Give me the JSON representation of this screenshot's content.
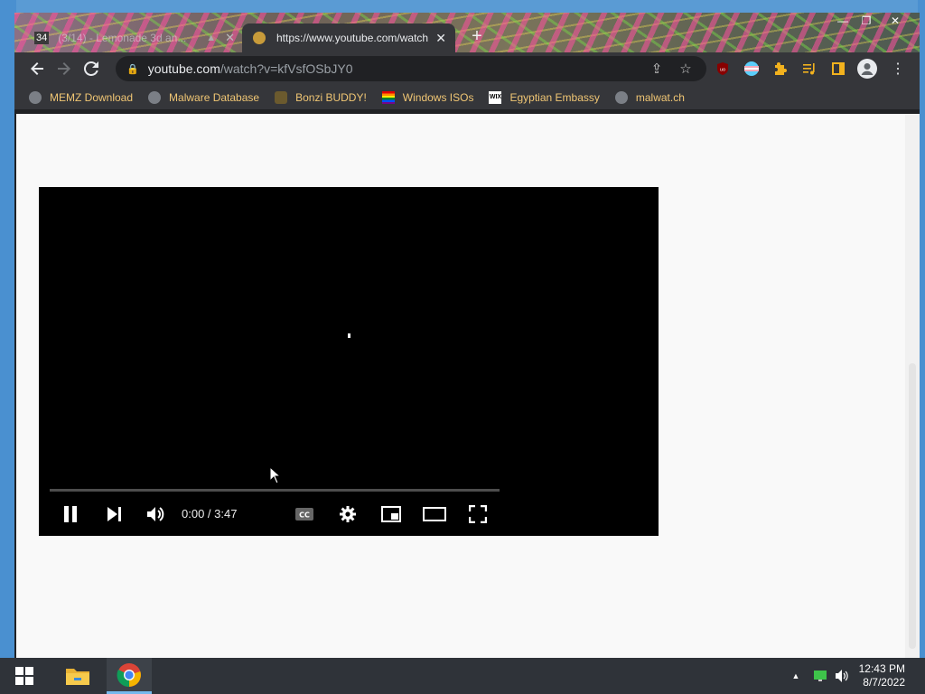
{
  "tabs": [
    {
      "title": "(3/14) - Lemonade 3d an...",
      "badge": "34",
      "active": false
    },
    {
      "title": "https://www.youtube.com/watch",
      "active": true
    }
  ],
  "address_bar": {
    "host": "youtube.com",
    "path": "/watch?v=kfVsfOSbJY0"
  },
  "bookmarks": [
    {
      "label": "MEMZ Download",
      "icon": "globe-icon"
    },
    {
      "label": "Malware Database",
      "icon": "globe-icon"
    },
    {
      "label": "Bonzi BUDDY!",
      "icon": "bonzi-icon"
    },
    {
      "label": "Windows ISOs",
      "icon": "rainbow-flag-icon"
    },
    {
      "label": "Egyptian Embassy",
      "icon": "wix-icon"
    },
    {
      "label": "malwat.ch",
      "icon": "globe-icon"
    }
  ],
  "player": {
    "current_time": "0:00",
    "duration": "3:47",
    "time_display": "0:00 / 3:47",
    "state": "playing"
  },
  "taskbar": {
    "time": "12:43 PM",
    "date": "8/7/2022"
  },
  "colors": {
    "bookmark_text": "#f0c674",
    "toolbar_bg": "#35363a",
    "page_bg": "#f9f9f9"
  }
}
